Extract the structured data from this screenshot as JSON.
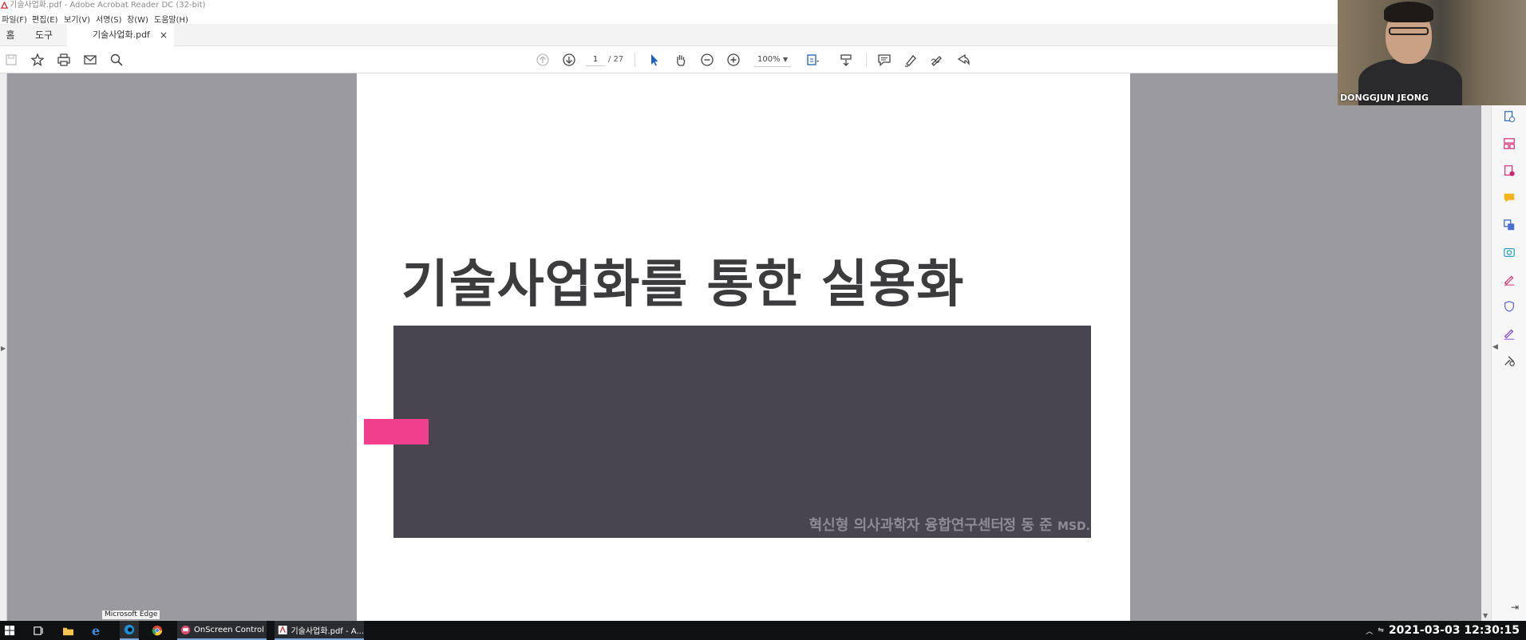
{
  "window": {
    "title": "기술사업화.pdf - Adobe Acrobat Reader DC (32-bit)"
  },
  "menu": {
    "items": [
      "파일(F)",
      "편집(E)",
      "보기(V)",
      "서명(S)",
      "창(W)",
      "도움말(H)"
    ]
  },
  "tabs": {
    "home": "홈",
    "tools": "도구",
    "document": "기술사업화.pdf",
    "close": "×"
  },
  "toolbar": {
    "current_page": "1",
    "total_pages": "/ 27",
    "zoom": "100%",
    "left_icons": [
      "save-icon",
      "star-icon",
      "print-icon",
      "email-icon",
      "search-icon"
    ],
    "nav_icons": [
      "page-up-icon",
      "page-down-icon"
    ],
    "right_icons": [
      "comment-icon",
      "highlight-icon",
      "sign-icon",
      "share-icon"
    ]
  },
  "slide": {
    "title": "기술사업화를 통한 실용화",
    "org": "혁신형 의사과학자 융합연구센터",
    "author": "정 동 준",
    "author_suffix": "MSD.",
    "colors": {
      "box": "#48454f",
      "accent": "#ef3f8d",
      "title": "#3c3c3e"
    }
  },
  "webcam": {
    "name": "DONGGJUN JEONG"
  },
  "right_panel": {
    "icons": [
      "export-pdf-icon",
      "organize-pages-icon",
      "create-pdf-icon",
      "comment-tool-icon",
      "translate-icon",
      "scan-icon",
      "fill-sign-icon",
      "protect-icon",
      "sign-tool-icon",
      "more-tools-icon"
    ]
  },
  "taskbar": {
    "tooltip": "Microsoft Edge",
    "apps": [
      {
        "name": "onscreen-control",
        "label": "OnScreen Control"
      },
      {
        "name": "acrobat",
        "label": "기술사업화.pdf - A..."
      }
    ],
    "clock": "2021-03-03  12:30:15"
  }
}
